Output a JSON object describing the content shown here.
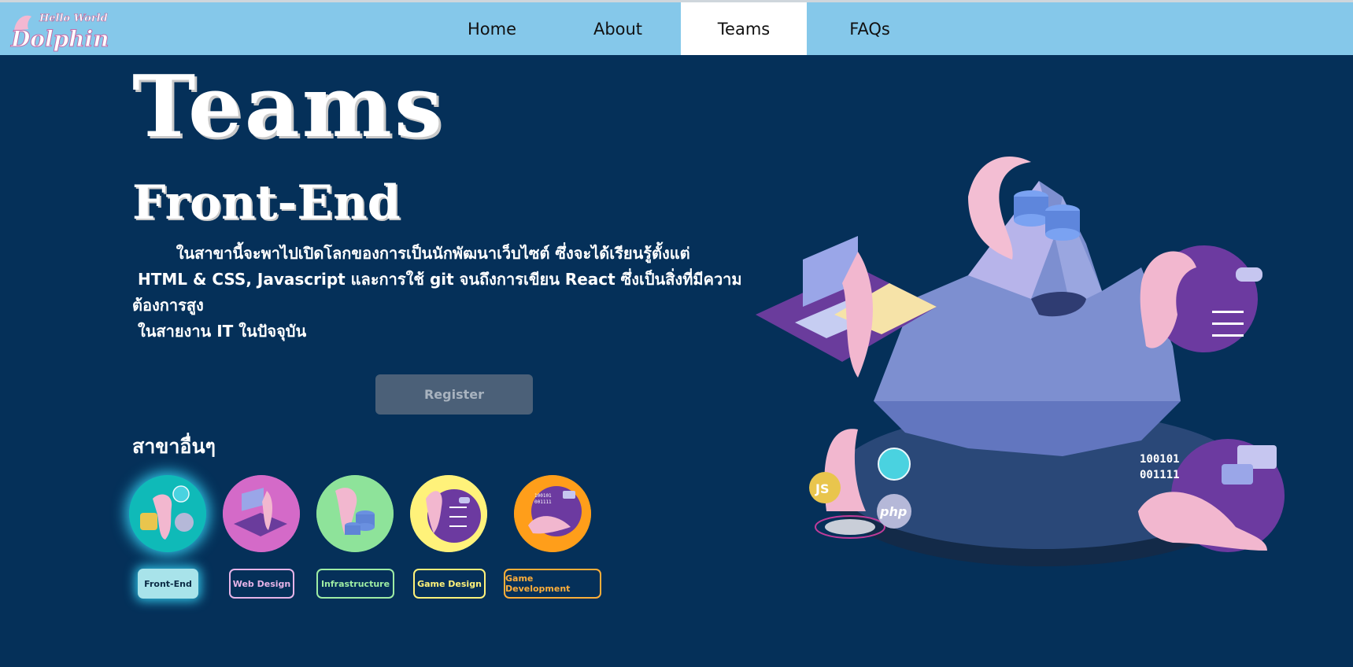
{
  "nav": {
    "logo_text_top": "Hello World",
    "logo_text_main": "Dolphin",
    "items": [
      {
        "label": "Home"
      },
      {
        "label": "About"
      },
      {
        "label": "Teams",
        "active": true
      },
      {
        "label": "FAQs"
      }
    ]
  },
  "main": {
    "title": "Teams",
    "section_title": "Front-End",
    "description": [
      "        ในสาขานี้จะพาไปเปิดโลกของการเป็นนักพัฒนาเว็บไซต์ ซึ่งจะได้เรียนรู้ตั้งแต่",
      " HTML & CSS, Javascript และการใช้ git จนถึงการเขียน React ซึ่งเป็นสิ่งที่มีความ",
      "ต้องการสูง",
      " ในสายงาน IT ในปัจจุบัน"
    ],
    "register_label": "Register",
    "others_title": "สาขาอื่นๆ",
    "branches": [
      {
        "label": "Front-End",
        "selected": true,
        "bg": "#0fbab8",
        "tag_bg": "#a8e3ea",
        "tag_text": "#0b2a44"
      },
      {
        "label": "Web Design",
        "bg": "#d46ac8",
        "tag_border": "#e7b4e8",
        "tag_text": "#e7b4e8"
      },
      {
        "label": "Infrastructure",
        "bg": "#8ee39a",
        "tag_border": "#9eeca4",
        "tag_text": "#9eeca4"
      },
      {
        "label": "Game Design",
        "bg": "#fff27a",
        "tag_border": "#fff27a",
        "tag_text": "#fff27a"
      },
      {
        "label": "Game Development",
        "bg": "#ff9e1a",
        "tag_border": "#ffae3a",
        "tag_text": "#ffae3a"
      }
    ]
  },
  "illustration": {
    "binary_1": "100101",
    "binary_2": "001111",
    "js": "JS",
    "php": "php"
  },
  "colors": {
    "navbar": "#85c8ea",
    "background": "#053059",
    "register_bg": "#4b6078"
  }
}
